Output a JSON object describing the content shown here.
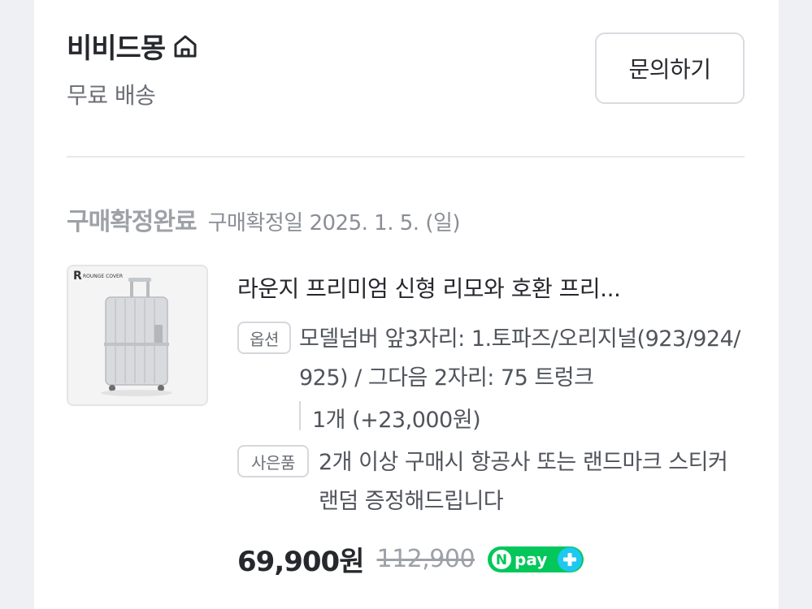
{
  "store": {
    "name": "비비드몽",
    "shipping": "무료 배송",
    "inquiry_label": "문의하기"
  },
  "order": {
    "status": "구매확정완료",
    "confirm_date": "구매확정일 2025. 1. 5. (일)"
  },
  "product": {
    "thumbnail_brand": "ROUNGE COVER",
    "title": "라운지 프리미엄 신형 리모와 호환 프리...",
    "option_tag": "옵션",
    "option_text": "모델넘버 앞3자리: 1.토파즈/오리지널(923/924/925) / 그다음 2자리: 75 트렁크",
    "option_qty": "1개 (+23,000원)",
    "gift_tag": "사은품",
    "gift_text": "2개 이상 구매시 항공사 또는 랜드마크 스티커 랜덤 증정해드립니다",
    "price": "69,900원",
    "original_price": "112,900",
    "pay_badge": "pay"
  },
  "colors": {
    "npay_green": "#03c75a",
    "npay_plus": "#1ec8f0"
  }
}
